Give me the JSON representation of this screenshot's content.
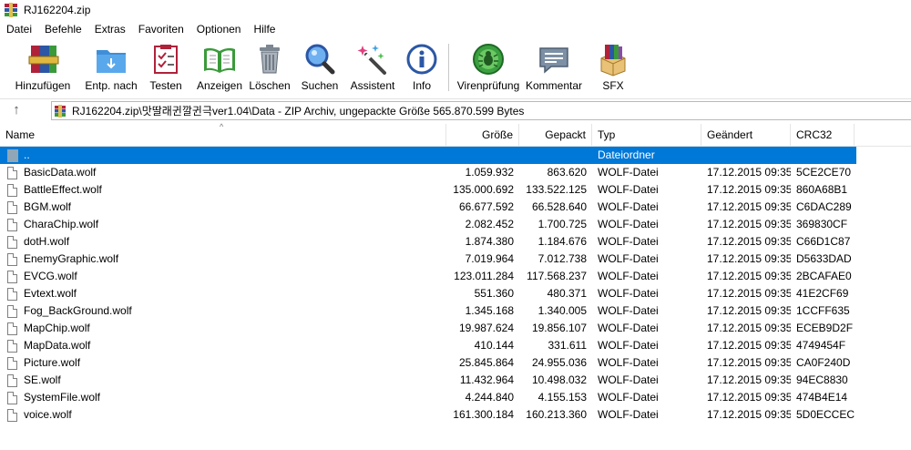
{
  "window": {
    "title": "RJ162204.zip"
  },
  "menu": [
    "Datei",
    "Befehle",
    "Extras",
    "Favoriten",
    "Optionen",
    "Hilfe"
  ],
  "toolbar": [
    {
      "label": "Hinzufügen",
      "icon": "add-archive-icon"
    },
    {
      "label": "Entp. nach",
      "icon": "extract-folder-icon"
    },
    {
      "label": "Testen",
      "icon": "test-checklist-icon"
    },
    {
      "label": "Anzeigen",
      "icon": "view-book-icon"
    },
    {
      "label": "Löschen",
      "icon": "trash-icon"
    },
    {
      "label": "Suchen",
      "icon": "search-icon"
    },
    {
      "label": "Assistent",
      "icon": "wizard-wand-icon"
    },
    {
      "label": "Info",
      "icon": "info-icon"
    },
    {
      "label": "Virenprüfung",
      "icon": "virus-scan-icon"
    },
    {
      "label": "Kommentar",
      "icon": "comment-icon"
    },
    {
      "label": "SFX",
      "icon": "sfx-box-icon"
    }
  ],
  "address": {
    "path": "RJ162204.zip\\맛딸래귄깔귄극ver1.04\\Data - ZIP Archiv, ungepackte Größe 565.870.599 Bytes",
    "up_symbol": "↑"
  },
  "columns": {
    "name": "Name",
    "size": "Größe",
    "packed": "Gepackt",
    "type": "Typ",
    "modified": "Geändert",
    "crc": "CRC32"
  },
  "parent_row": {
    "name": "..",
    "type": "Dateiordner"
  },
  "files": [
    {
      "name": "BasicData.wolf",
      "size": "1.059.932",
      "packed": "863.620",
      "type": "WOLF-Datei",
      "modified": "17.12.2015 09:35",
      "crc": "5CE2CE70"
    },
    {
      "name": "BattleEffect.wolf",
      "size": "135.000.692",
      "packed": "133.522.125",
      "type": "WOLF-Datei",
      "modified": "17.12.2015 09:35",
      "crc": "860A68B1"
    },
    {
      "name": "BGM.wolf",
      "size": "66.677.592",
      "packed": "66.528.640",
      "type": "WOLF-Datei",
      "modified": "17.12.2015 09:35",
      "crc": "C6DAC289"
    },
    {
      "name": "CharaChip.wolf",
      "size": "2.082.452",
      "packed": "1.700.725",
      "type": "WOLF-Datei",
      "modified": "17.12.2015 09:35",
      "crc": "369830CF"
    },
    {
      "name": "dotH.wolf",
      "size": "1.874.380",
      "packed": "1.184.676",
      "type": "WOLF-Datei",
      "modified": "17.12.2015 09:35",
      "crc": "C66D1C87"
    },
    {
      "name": "EnemyGraphic.wolf",
      "size": "7.019.964",
      "packed": "7.012.738",
      "type": "WOLF-Datei",
      "modified": "17.12.2015 09:35",
      "crc": "D5633DAD"
    },
    {
      "name": "EVCG.wolf",
      "size": "123.011.284",
      "packed": "117.568.237",
      "type": "WOLF-Datei",
      "modified": "17.12.2015 09:35",
      "crc": "2BCAFAE0"
    },
    {
      "name": "Evtext.wolf",
      "size": "551.360",
      "packed": "480.371",
      "type": "WOLF-Datei",
      "modified": "17.12.2015 09:35",
      "crc": "41E2CF69"
    },
    {
      "name": "Fog_BackGround.wolf",
      "size": "1.345.168",
      "packed": "1.340.005",
      "type": "WOLF-Datei",
      "modified": "17.12.2015 09:35",
      "crc": "1CCFF635"
    },
    {
      "name": "MapChip.wolf",
      "size": "19.987.624",
      "packed": "19.856.107",
      "type": "WOLF-Datei",
      "modified": "17.12.2015 09:35",
      "crc": "ECEB9D2F"
    },
    {
      "name": "MapData.wolf",
      "size": "410.144",
      "packed": "331.611",
      "type": "WOLF-Datei",
      "modified": "17.12.2015 09:35",
      "crc": "4749454F"
    },
    {
      "name": "Picture.wolf",
      "size": "25.845.864",
      "packed": "24.955.036",
      "type": "WOLF-Datei",
      "modified": "17.12.2015 09:35",
      "crc": "CA0F240D"
    },
    {
      "name": "SE.wolf",
      "size": "11.432.964",
      "packed": "10.498.032",
      "type": "WOLF-Datei",
      "modified": "17.12.2015 09:35",
      "crc": "94EC8830"
    },
    {
      "name": "SystemFile.wolf",
      "size": "4.244.840",
      "packed": "4.155.153",
      "type": "WOLF-Datei",
      "modified": "17.12.2015 09:35",
      "crc": "474B4E14"
    },
    {
      "name": "voice.wolf",
      "size": "161.300.184",
      "packed": "160.213.360",
      "type": "WOLF-Datei",
      "modified": "17.12.2015 09:35",
      "crc": "5D0ECCEC"
    }
  ],
  "colors": {
    "selection": "#0078d7",
    "winrar_red": "#b0223a",
    "winrar_blue": "#2b57a5"
  }
}
